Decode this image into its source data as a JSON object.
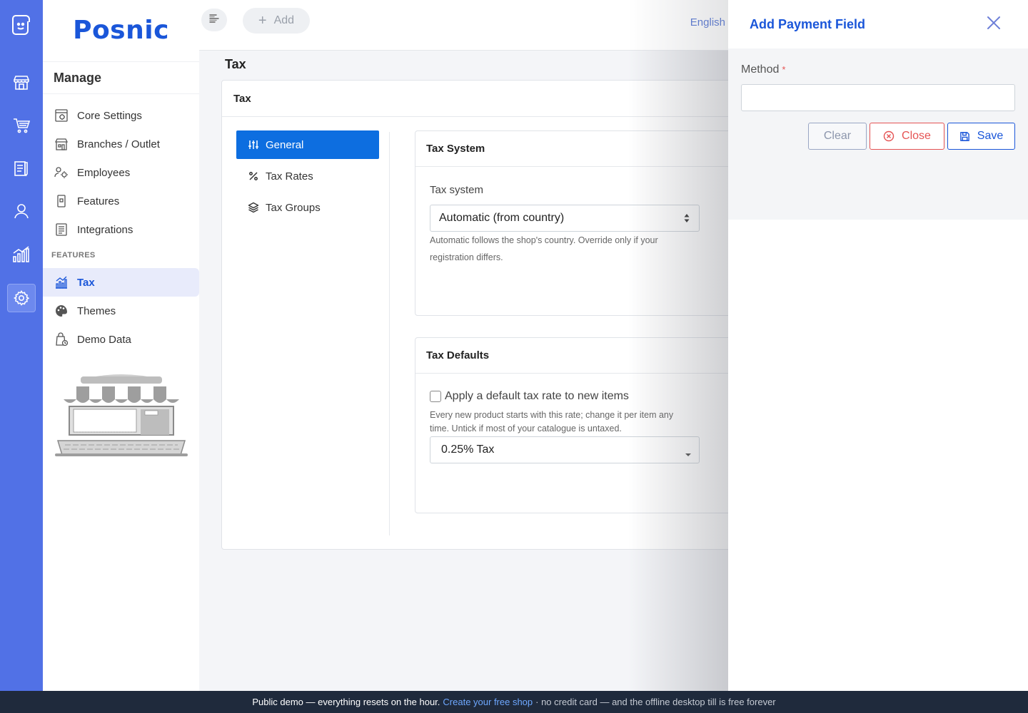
{
  "brand": {
    "name": "Posnic"
  },
  "menu": {
    "heading": "Manage",
    "items": [
      {
        "label": "Core Settings",
        "icon": "core-settings-icon"
      },
      {
        "label": "Branches / Outlet",
        "icon": "branches-icon"
      },
      {
        "label": "Employees",
        "icon": "employees-icon"
      },
      {
        "label": "Features",
        "icon": "features-icon"
      },
      {
        "label": "Integrations",
        "icon": "integrations-icon"
      }
    ],
    "section_label": "FEATURES",
    "feature_items": [
      {
        "label": "Tax",
        "icon": "tax-icon",
        "active": true
      },
      {
        "label": "Themes",
        "icon": "palette-icon"
      },
      {
        "label": "Demo Data",
        "icon": "demo-data-icon"
      }
    ]
  },
  "topbar": {
    "add_label": "Add",
    "language": "English"
  },
  "page": {
    "title": "Tax"
  },
  "tax_card": {
    "title": "Tax",
    "nav": [
      {
        "label": "General",
        "icon": "sliders-icon",
        "active": true
      },
      {
        "label": "Tax Rates",
        "icon": "percent-icon"
      },
      {
        "label": "Tax Groups",
        "icon": "layers-icon"
      }
    ],
    "tax_system": {
      "title": "Tax System",
      "field_label": "Tax system",
      "selected": "Automatic (from country)",
      "help": "Automatic follows the shop's country. Override only if your registration differs."
    },
    "tax_defaults": {
      "title": "Tax Defaults",
      "checkbox_label": "Apply a default tax rate to new items",
      "checked": false,
      "help": "Every new product starts with this rate; change it per item any time. Untick if most of your catalogue is untaxed.",
      "selected_rate": "0.25% Tax"
    }
  },
  "drawer": {
    "title": "Add Payment Field",
    "method_label": "Method",
    "required_mark": "*",
    "method_value": "",
    "buttons": {
      "clear": "Clear",
      "close": "Close",
      "save": "Save"
    }
  },
  "footer": {
    "lead": "Public demo — everything resets on the hour.",
    "link": "Create your free shop",
    "tail": "· no credit card — and the offline desktop till is free forever"
  },
  "colors": {
    "rail": "#5171e6",
    "accent": "#1a56d9",
    "primary_button": "#0d6ee0",
    "danger": "#e55353",
    "footer": "#1f2a3c"
  }
}
